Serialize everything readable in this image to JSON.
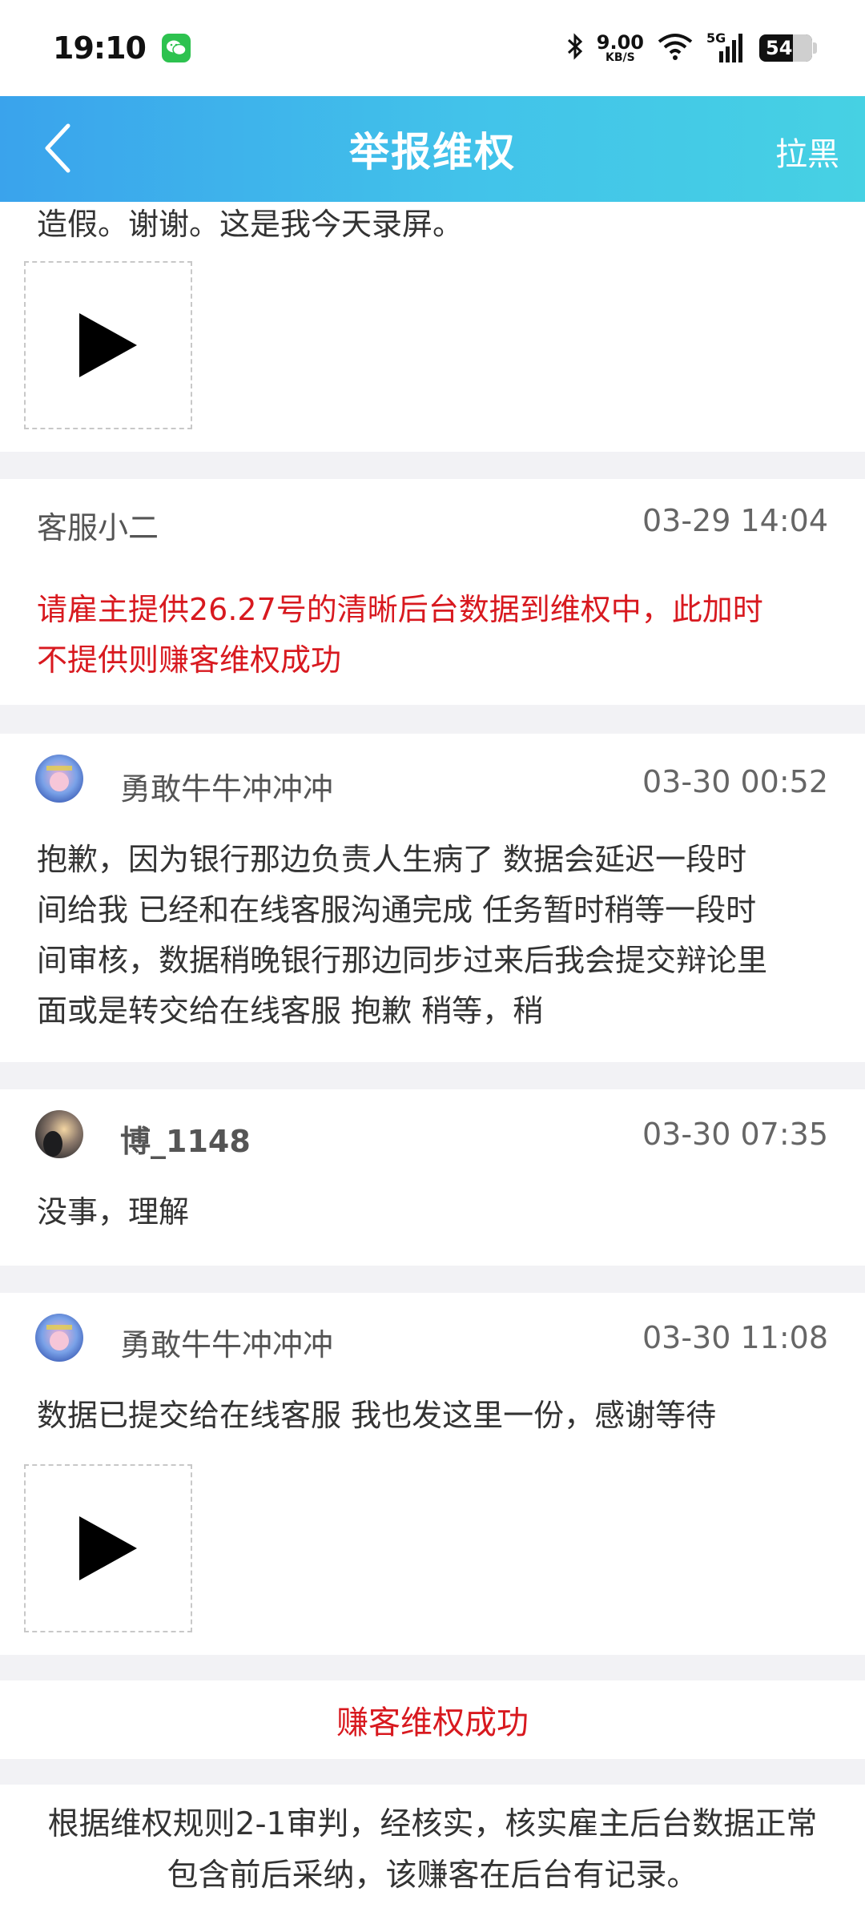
{
  "status_bar": {
    "time": "19:10",
    "net_speed_value": "9.00",
    "net_speed_unit": "KB/S",
    "network": "5G",
    "battery": "54"
  },
  "nav": {
    "title": "举报维权",
    "right_action": "拉黑"
  },
  "top_card": {
    "text": "造假。谢谢。这是我今天录屏。"
  },
  "messages": [
    {
      "name": "客服小二",
      "time": "03-29 14:04",
      "lines": [
        "请雇主提供26.27号的清晰后台数据到维权中，此加时",
        "不提供则赚客维权成功"
      ]
    },
    {
      "name": "勇敢牛牛冲冲冲",
      "time": "03-30 00:52",
      "lines": [
        "抱歉，因为银行那边负责人生病了 数据会延迟一段时",
        "间给我 已经和在线客服沟通完成 任务暂时稍等一段时",
        "间审核，数据稍晚银行那边同步过来后我会提交辩论里",
        "面或是转交给在线客服 抱歉 稍等，稍"
      ]
    },
    {
      "name": "博_1148",
      "time": "03-30 07:35",
      "lines": [
        "没事，理解"
      ]
    },
    {
      "name": "勇敢牛牛冲冲冲",
      "time": "03-30 11:08",
      "lines": [
        "数据已提交给在线客服 我也发这里一份，感谢等待"
      ]
    }
  ],
  "result": {
    "title": "赚客维权成功",
    "desc_lines": [
      "根据维权规则2-1审判，经核实，核实雇主后台数据正常",
      "包含前后采纳，该赚客在后台有记录。"
    ]
  }
}
